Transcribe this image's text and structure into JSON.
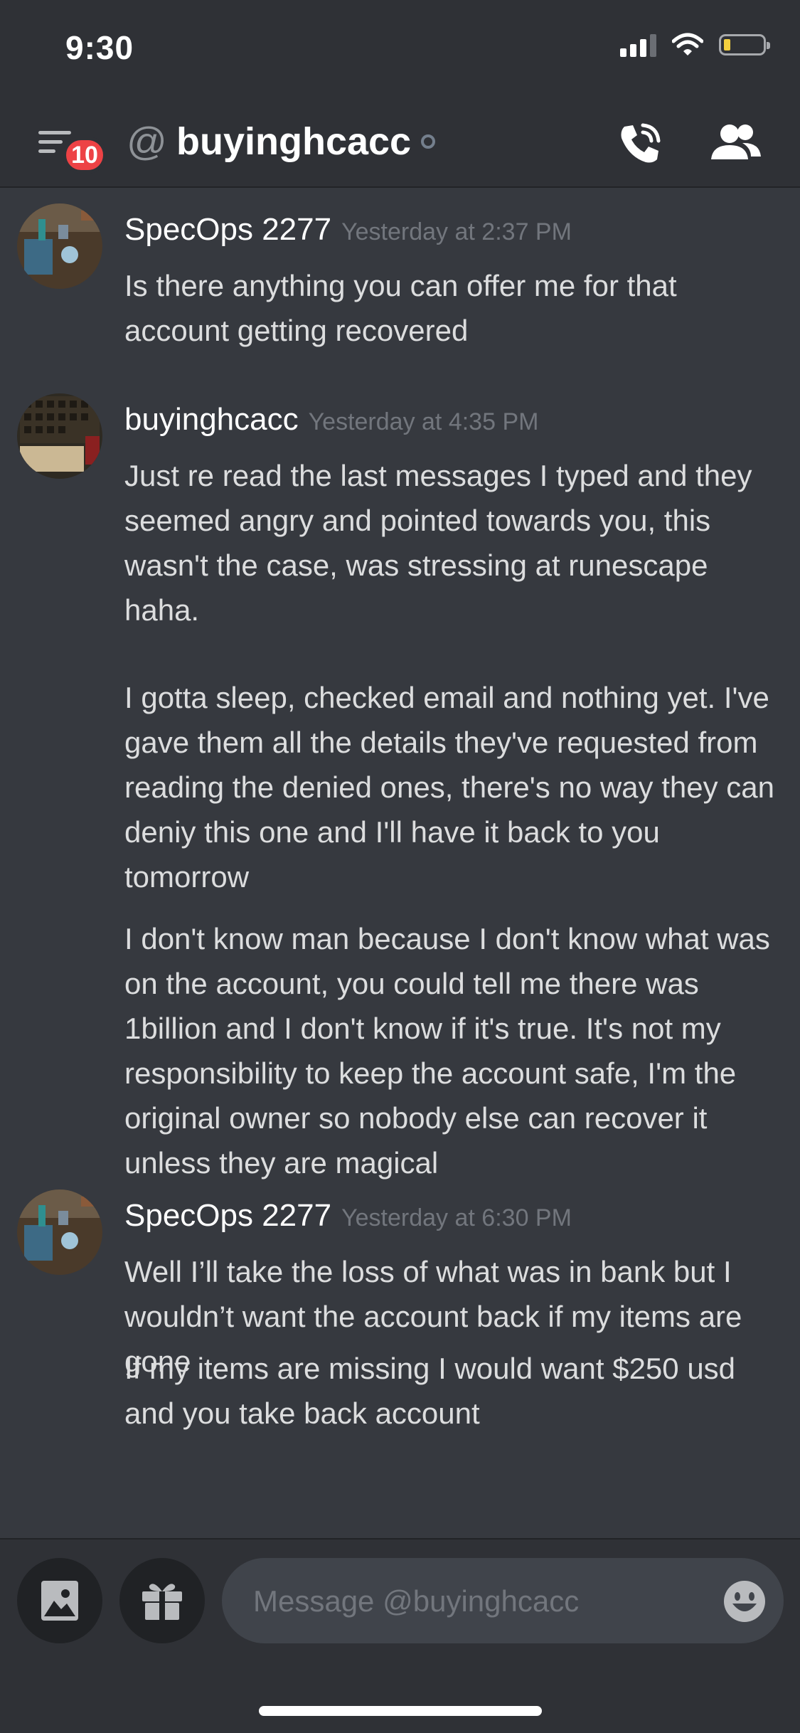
{
  "status_bar": {
    "time": "9:30",
    "icons": [
      "cellular-signal-icon",
      "wifi-icon",
      "battery-low-icon"
    ]
  },
  "header": {
    "unread_badge": "10",
    "channel_name": "buyinghcacc",
    "icons": [
      "hamburger-menu-icon",
      "at-icon",
      "offline-status-icon",
      "start-voice-call-icon",
      "members-icon"
    ]
  },
  "messages": [
    {
      "author": "SpecOps 2277",
      "timestamp": "Yesterday at 2:37 PM",
      "lines": [
        "Is there anything you can offer me for that account getting recovered"
      ]
    },
    {
      "author": "buyinghcacc",
      "timestamp": "Yesterday at 4:35 PM",
      "lines": [
        "Just re read the last messages I typed and they seemed angry and pointed towards you, this wasn't the case, was stressing at runescape haha.",
        "I gotta sleep, checked email and nothing yet. I've gave them all the details they've requested from reading the denied ones, there's no way they can deniy this one and I'll have it back to you tomorrow",
        "I don't know man because I don't know what was on the account, you could tell me there was 1billion and I don't know if it's true. It's not my responsibility to keep the account safe, I'm the original owner so nobody else can recover it unless they are magical"
      ]
    },
    {
      "author": "SpecOps 2277",
      "timestamp": "Yesterday at 6:30 PM",
      "lines": [
        "Well I’ll take the loss of what was in bank but I wouldn’t want the account back if my items are gone",
        "If my items are missing I would want $250 usd and you take back account"
      ]
    }
  ],
  "composer": {
    "placeholder": "Message @buyinghcacc",
    "icons": [
      "image-upload-icon",
      "gift-icon",
      "emoji-icon"
    ]
  },
  "colors": {
    "background": "#36393f",
    "header": "#2f3136",
    "badge": "#ed4245",
    "timestamp": "#72767d",
    "text": "#dcddde"
  }
}
